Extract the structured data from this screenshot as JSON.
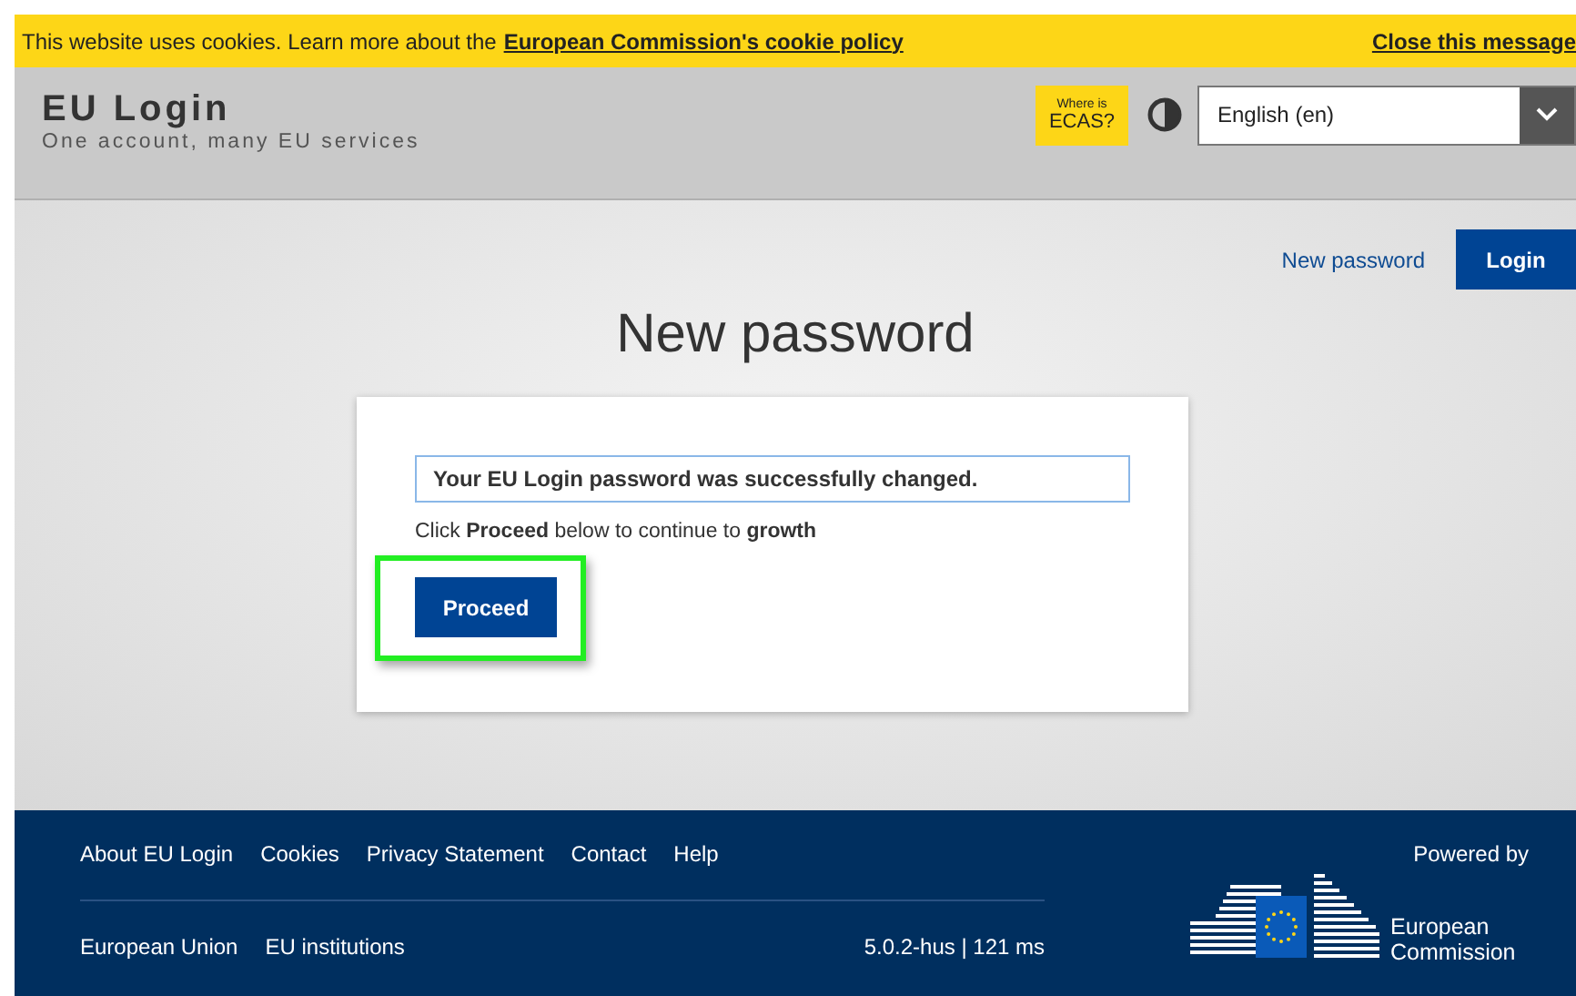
{
  "cookie_bar": {
    "text": "This website uses cookies. Learn more about the",
    "link": "European Commission's cookie policy",
    "close": "Close this message"
  },
  "header": {
    "title": "EU Login",
    "subtitle": "One account, many EU services",
    "ecas_small": "Where is",
    "ecas_big": "ECAS?",
    "language": "English (en)"
  },
  "nav": {
    "new_password": "New password",
    "login": "Login"
  },
  "page_title": "New password",
  "card": {
    "message": "Your EU Login password was successfully changed.",
    "instruction": "Click **Proceed** below to continue to **growth**",
    "button": {
      "label": "Proceed",
      "highlighted": true
    }
  },
  "footer": {
    "links": [
      "About EU Login",
      "Cookies",
      "Privacy Statement",
      "Contact",
      "Help"
    ],
    "bottom_links": [
      "European Union",
      "EU institutions"
    ],
    "version": "5.0.2-hus | 121 ms",
    "powered_by": "Powered by",
    "logo_text": "European Commission"
  }
}
